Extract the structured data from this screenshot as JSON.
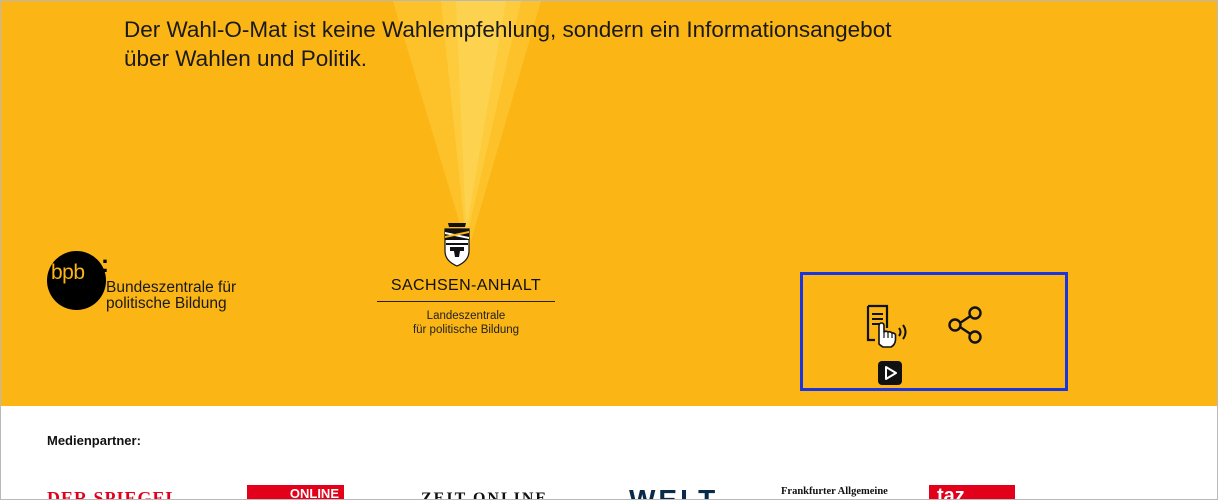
{
  "footer": {
    "disclaimer_line1": "Der Wahl-O-Mat ist keine Wahlempfehlung, sondern ein Informationsangebot",
    "disclaimer_line2": "über Wahlen und Politik.",
    "background_color": "#fbb515"
  },
  "logos": {
    "bpb": {
      "abbr": "bpb",
      "colon": ":",
      "line1": "Bundeszentrale für",
      "line2": "politische Bildung"
    },
    "sachsen_anhalt": {
      "name": "SACHSEN-ANHALT",
      "line1": "Landeszentrale",
      "line2": "für politische Bildung"
    }
  },
  "actions": {
    "read_aloud_icon": "read-aloud-icon",
    "share_icon": "share-icon",
    "play_icon": "play-icon",
    "highlight_color": "#1a35e0"
  },
  "partners": {
    "label": "Medienpartner:",
    "logos": [
      "DER SPIEGEL",
      "ONLINE",
      "ZEIT ONLINE",
      "WELT",
      "Frankfurter Allgemeine",
      "taz"
    ]
  }
}
